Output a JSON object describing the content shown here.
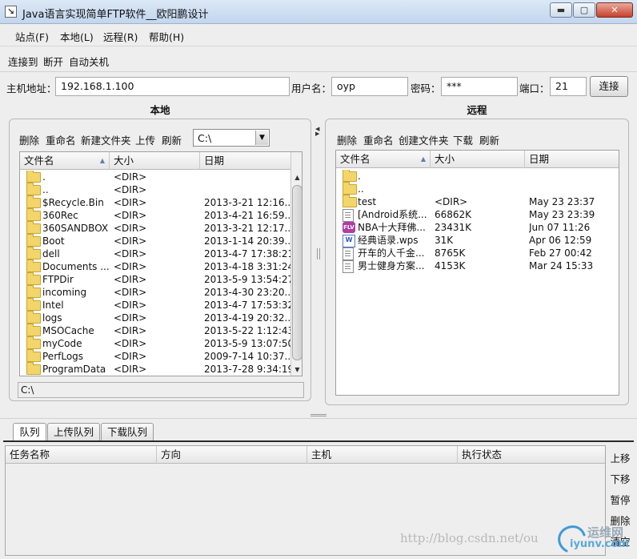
{
  "window": {
    "title": "Java语言实现简单FTP软件__欧阳鹏设计",
    "min_glyph": "▬",
    "max_glyph": "▢",
    "close_glyph": "✕"
  },
  "menu": [
    "站点(F)",
    "本地(L)",
    "远程(R)",
    "帮助(H)"
  ],
  "toolbar": [
    "连接到",
    "断开",
    "自动关机"
  ],
  "connection": {
    "host_label": "主机地址：",
    "host_value": "192.168.1.100",
    "user_label": "用户名：",
    "user_value": "oyp",
    "pass_label": "密码：",
    "pass_value": "***",
    "port_label": "端口：",
    "port_value": "21",
    "connect_label": "连接"
  },
  "local": {
    "title": "本地",
    "tools": [
      "删除",
      "重命名",
      "新建文件夹",
      "上传",
      "刷新"
    ],
    "drive": "C:\\",
    "columns": [
      "文件名",
      "大小",
      "日期"
    ],
    "rows": [
      {
        "name": ".",
        "size": "<DIR>",
        "date": ""
      },
      {
        "name": "..",
        "size": "<DIR>",
        "date": ""
      },
      {
        "name": "$Recycle.Bin",
        "size": "<DIR>",
        "date": "2013-3-21 12:16..."
      },
      {
        "name": "360Rec",
        "size": "<DIR>",
        "date": "2013-4-21 16:59..."
      },
      {
        "name": "360SANDBOX",
        "size": "<DIR>",
        "date": "2013-3-21 12:17..."
      },
      {
        "name": "Boot",
        "size": "<DIR>",
        "date": "2013-1-14 20:39..."
      },
      {
        "name": "dell",
        "size": "<DIR>",
        "date": "2013-4-7 17:38:21"
      },
      {
        "name": "Documents ...",
        "size": "<DIR>",
        "date": "2013-4-18 3:31:24"
      },
      {
        "name": "FTPDir",
        "size": "<DIR>",
        "date": "2013-5-9 13:54:27"
      },
      {
        "name": "incoming",
        "size": "<DIR>",
        "date": "2013-4-30 23:20..."
      },
      {
        "name": "Intel",
        "size": "<DIR>",
        "date": "2013-4-7 17:53:32"
      },
      {
        "name": "logs",
        "size": "<DIR>",
        "date": "2013-4-19 20:32..."
      },
      {
        "name": "MSOCache",
        "size": "<DIR>",
        "date": "2013-5-22 1:12:43"
      },
      {
        "name": "myCode",
        "size": "<DIR>",
        "date": "2013-5-9 13:07:50"
      },
      {
        "name": "PerfLogs",
        "size": "<DIR>",
        "date": "2009-7-14 10:37..."
      },
      {
        "name": "ProgramData",
        "size": "<DIR>",
        "date": "2013-7-28 9:34:19"
      }
    ],
    "status_path": "C:\\"
  },
  "remote": {
    "title": "远程",
    "tools": [
      "删除",
      "重命名",
      "创建文件夹",
      "下载",
      "刷新"
    ],
    "columns": [
      "文件名",
      "大小",
      "日期"
    ],
    "rows": [
      {
        "name": ".",
        "size": "",
        "date": "",
        "icon": "folder"
      },
      {
        "name": "..",
        "size": "",
        "date": "",
        "icon": "folder"
      },
      {
        "name": "test",
        "size": "<DIR>",
        "date": "May 23 23:37",
        "icon": "folder"
      },
      {
        "name": "[Android系统...",
        "size": "66862K",
        "date": "May 23 23:39",
        "icon": "file"
      },
      {
        "name": "NBA十大拜佛...",
        "size": "23431K",
        "date": "Jun 07 11:26",
        "icon": "flv"
      },
      {
        "name": "经典语录.wps",
        "size": "31K",
        "date": "Apr 06 12:59",
        "icon": "wps"
      },
      {
        "name": "开车的人千金...",
        "size": "8765K",
        "date": "Feb 27 00:42",
        "icon": "file"
      },
      {
        "name": "男士健身方案...",
        "size": "4153K",
        "date": "Mar 24 15:33",
        "icon": "file"
      }
    ]
  },
  "tabs": [
    "队列",
    "上传队列",
    "下载队列"
  ],
  "queue": {
    "columns": [
      "任务名称",
      "方向",
      "主机",
      "执行状态"
    ],
    "actions": [
      "上移",
      "下移",
      "暂停",
      "删除",
      "清空"
    ]
  },
  "watermark": {
    "url": "http://blog.csdn.net/ou",
    "cn": "运维网",
    "en": "iyunv.com"
  }
}
